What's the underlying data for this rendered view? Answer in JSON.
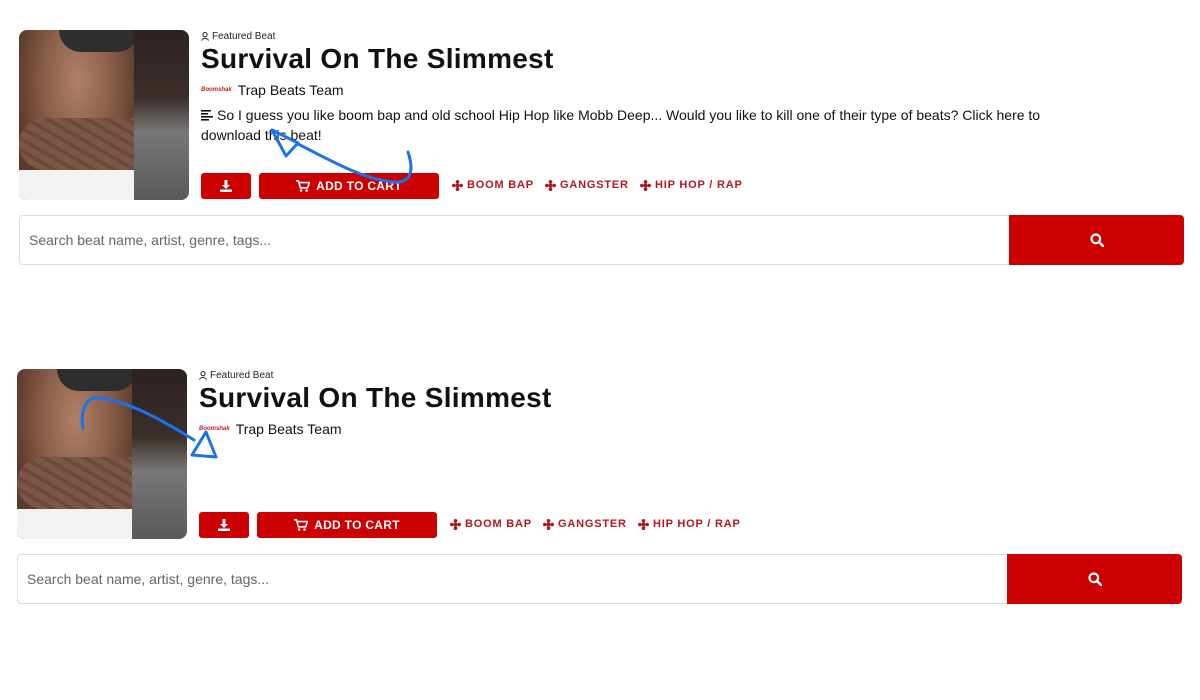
{
  "panels": [
    {
      "featured_label": "Featured Beat",
      "title": "Survival On The Slimmest",
      "artist_logo_text": "Boomshak",
      "artist": "Trap Beats Team",
      "description": "So I guess you like boom bap and old school Hip Hop like Mobb Deep... Would you like to kill one of their type of beats? Click here to download this beat!",
      "add_to_cart_label": "ADD TO CART",
      "tags": [
        "BOOM BAP",
        "GANGSTER",
        "HIP HOP / RAP"
      ],
      "search_placeholder": "Search beat name, artist, genre, tags..."
    },
    {
      "featured_label": "Featured Beat",
      "title": "Survival On The Slimmest",
      "artist_logo_text": "Boomshak",
      "artist": "Trap Beats Team",
      "add_to_cart_label": "ADD TO CART",
      "tags": [
        "BOOM BAP",
        "GANGSTER",
        "HIP HOP / RAP"
      ],
      "search_placeholder": "Search beat name, artist, genre, tags..."
    }
  ],
  "colors": {
    "accent": "#cc0000",
    "tag_text": "#b3171a",
    "annotation": "#1a73e8"
  },
  "icons": {
    "featured": "user-icon",
    "description": "align-left-icon",
    "download": "download-icon",
    "cart": "cart-icon",
    "tag": "tag-icon",
    "search": "search-icon"
  }
}
